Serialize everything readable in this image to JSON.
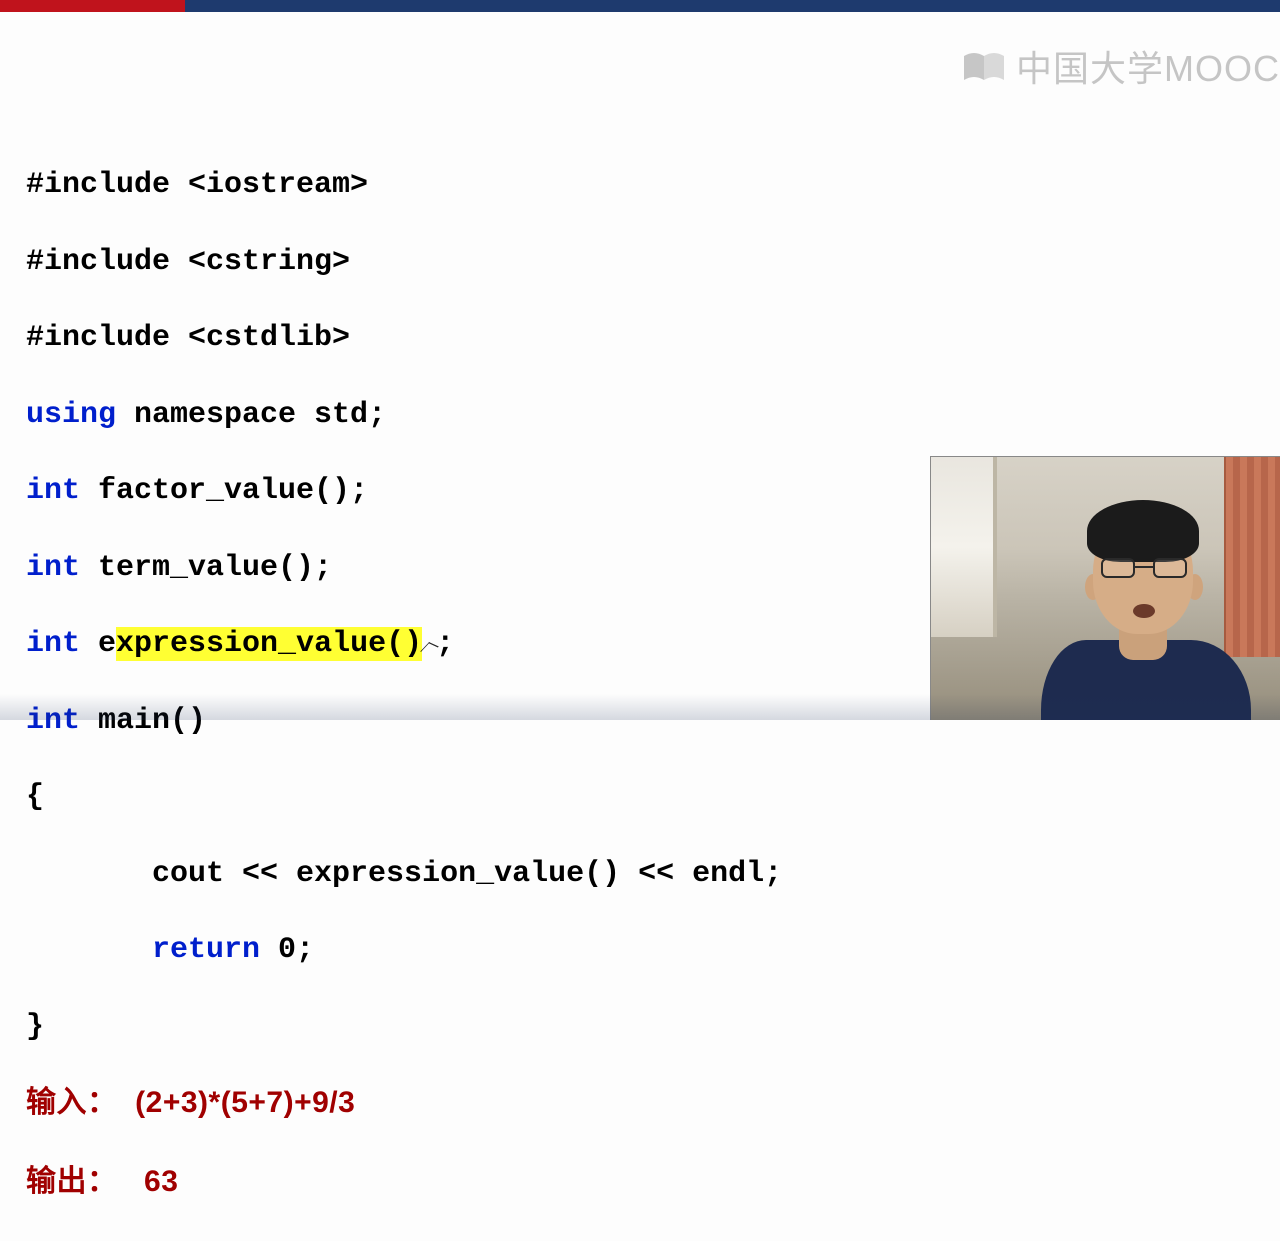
{
  "watermark": {
    "text": "中国大学MOOC"
  },
  "code": {
    "l1": "#include <iostream>",
    "l2": "#include <cstring>",
    "l3": "#include <cstdlib>",
    "l4a": "using",
    "l4b": " namespace std;",
    "l5a": "int",
    "l5b": " factor_value();",
    "l6a": "int",
    "l6b": " term_value();",
    "l7a": "int",
    "l7b_pre": " e",
    "l7b_hl": "xpression_value()",
    "l7b_post": ";",
    "l8a": "int",
    "l8b": " main()",
    "l9": "{",
    "l10": "       cout << expression_value() << endl;",
    "l11a": "       return",
    "l11b": " 0;",
    "l12": "}"
  },
  "io": {
    "in_label": "输入：  ",
    "in_value": "(2+3)*(5+7)+9/3",
    "out_label": "输出：   ",
    "out_value": "63"
  }
}
